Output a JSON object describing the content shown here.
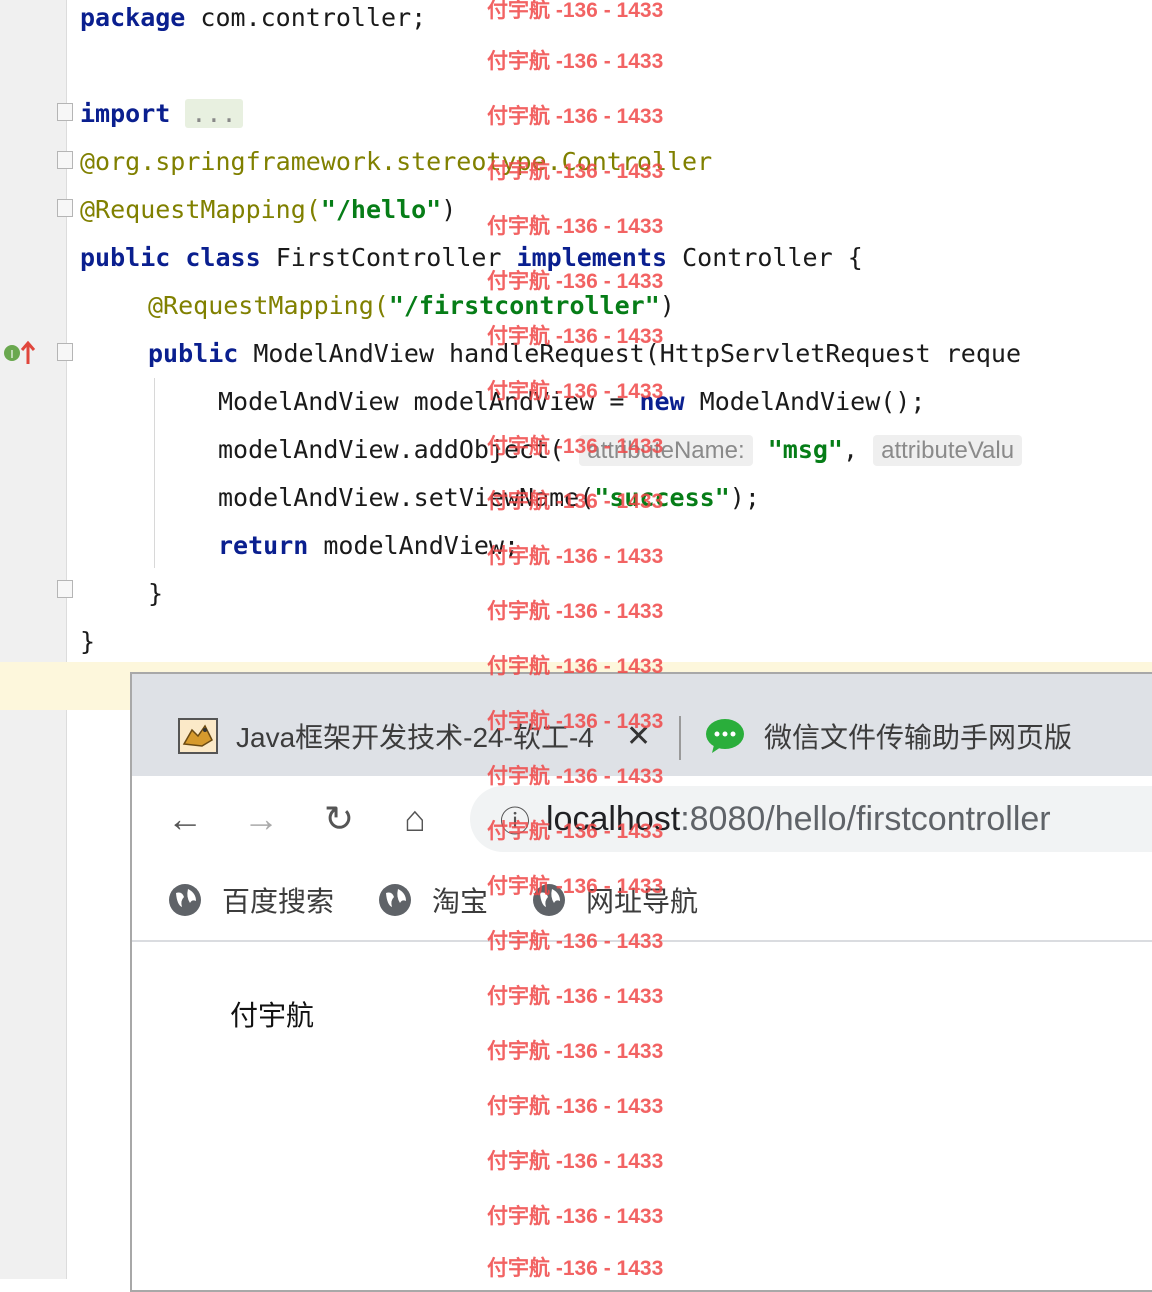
{
  "editor": {
    "lines": {
      "package_kw": "package",
      "package_name": " com.controller;",
      "import_kw": "import",
      "import_fold": "...",
      "controller_ann": "@org.springframework.stereotype.Controller",
      "req_map_ann": "@RequestMapping(",
      "req_map_str": "\"/hello\"",
      "req_map_close": ")",
      "public_kw": "public",
      "class_kw": "class",
      "class_name": "FirstController",
      "implements_kw": "implements",
      "class_tail": "Controller {",
      "method_ann": "@RequestMapping(",
      "method_ann_str": "\"/firstcontroller\"",
      "method_ann_close": ")",
      "method_public_kw": "public",
      "method_sig": "ModelAndView handleRequest(HttpServletRequest reque",
      "mav_decl": "ModelAndView modelAndView = ",
      "new_kw": "new",
      "mav_ctor": " ModelAndView();",
      "add_object_call": "modelAndView.addObject(",
      "hint_attr_name": "attributeName:",
      "msg_str": "\"msg\"",
      "comma": ",",
      "hint_attr_value": "attributeValu",
      "set_view_call": "modelAndView.setViewName(",
      "success_str": "\"success\"",
      "set_view_close": ");",
      "return_kw": "return",
      "return_val": " modelAndView;",
      "method_close": "}",
      "class_close": "}"
    }
  },
  "browser": {
    "tabs": [
      {
        "title": "Java框架开发技术-24-软工-4",
        "close": "✕"
      },
      {
        "title": "微信文件传输助手网页版"
      }
    ],
    "nav": {
      "back": "←",
      "forward": "→",
      "reload": "↻",
      "home": "⌂"
    },
    "address": {
      "host": "localhost",
      "rest": ":8080/hello/firstcontroller",
      "icon": "ⓘ"
    },
    "bookmarks": [
      "百度搜索",
      "淘宝",
      "网址导航"
    ],
    "page_text": "付宇航"
  },
  "watermark": "付宇航 -136 - 1433",
  "colors": {
    "keyword": "#0a1f8f",
    "annotation": "#808000",
    "string": "#067d17",
    "watermark": "#f04848"
  }
}
